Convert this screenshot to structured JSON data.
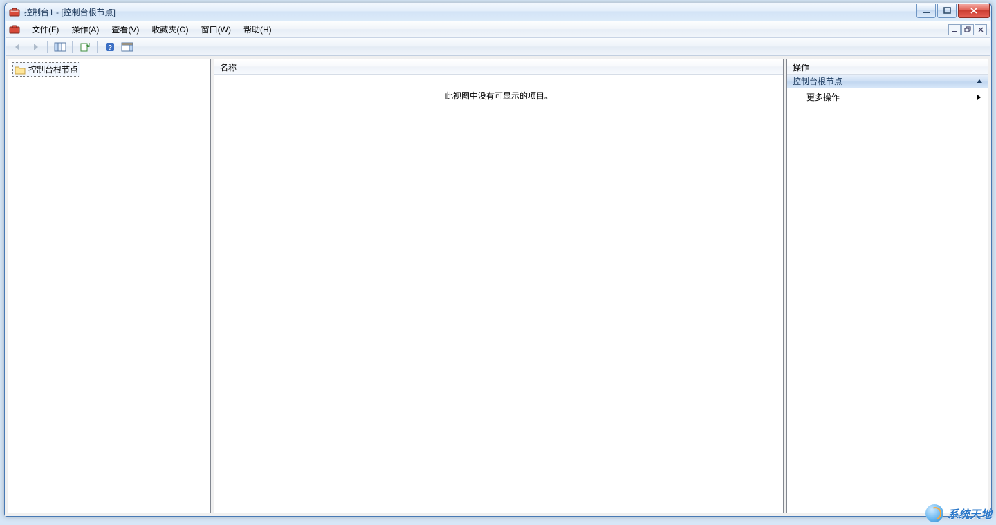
{
  "window": {
    "title": "控制台1 - [控制台根节点]"
  },
  "menubar": {
    "items": [
      {
        "label": "文件(F)"
      },
      {
        "label": "操作(A)"
      },
      {
        "label": "查看(V)"
      },
      {
        "label": "收藏夹(O)"
      },
      {
        "label": "窗口(W)"
      },
      {
        "label": "帮助(H)"
      }
    ]
  },
  "tree": {
    "root_label": "控制台根节点"
  },
  "list": {
    "column_name": "名称",
    "empty_message": "此视图中没有可显示的项目。"
  },
  "actions": {
    "pane_title": "操作",
    "section_title": "控制台根节点",
    "more_actions": "更多操作"
  },
  "watermark": {
    "text": "系统天地"
  }
}
